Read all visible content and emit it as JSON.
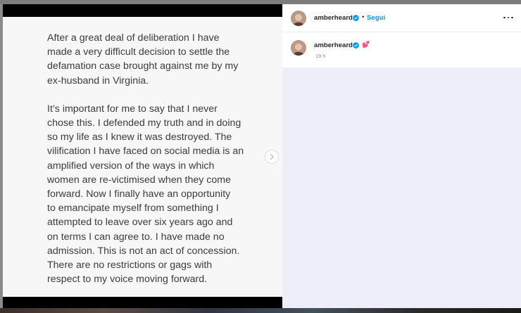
{
  "statement": {
    "paragraphs": [
      "After a great deal of deliberation I have\nmade a very difficult decision to settle the\ndefamation case brought against me by my\nex-husband in Virginia.",
      "It’s important for me to say that I never\nchose this. I defended my truth and in doing\nso my life as I knew it was destroyed. The\nvilification I have faced on social media is an\namplified version of the ways in which\nwomen are re-victimised when they come\nforward.  Now I finally have an opportunity\nto emancipate myself from something I\nattempted to leave over six years ago and\non terms I can agree to. I have made no\nadmission. This is not an act of concession.\nThere are no restrictions or gags with\nrespect to my voice moving forward."
    ]
  },
  "post_header": {
    "username": "amberheard",
    "separator": "•",
    "follow_label": "Segui"
  },
  "caption": {
    "username": "amberheard",
    "emoji": "💕",
    "time_ago": "19 h"
  },
  "icons": {
    "next": "chevron-right-icon",
    "verified": "verified-badge-icon",
    "more": "more-options-icon"
  },
  "colors": {
    "accent": "#0095f6",
    "comments_bg": "#eeeefb",
    "statement_bg": "#f7f7f7"
  }
}
